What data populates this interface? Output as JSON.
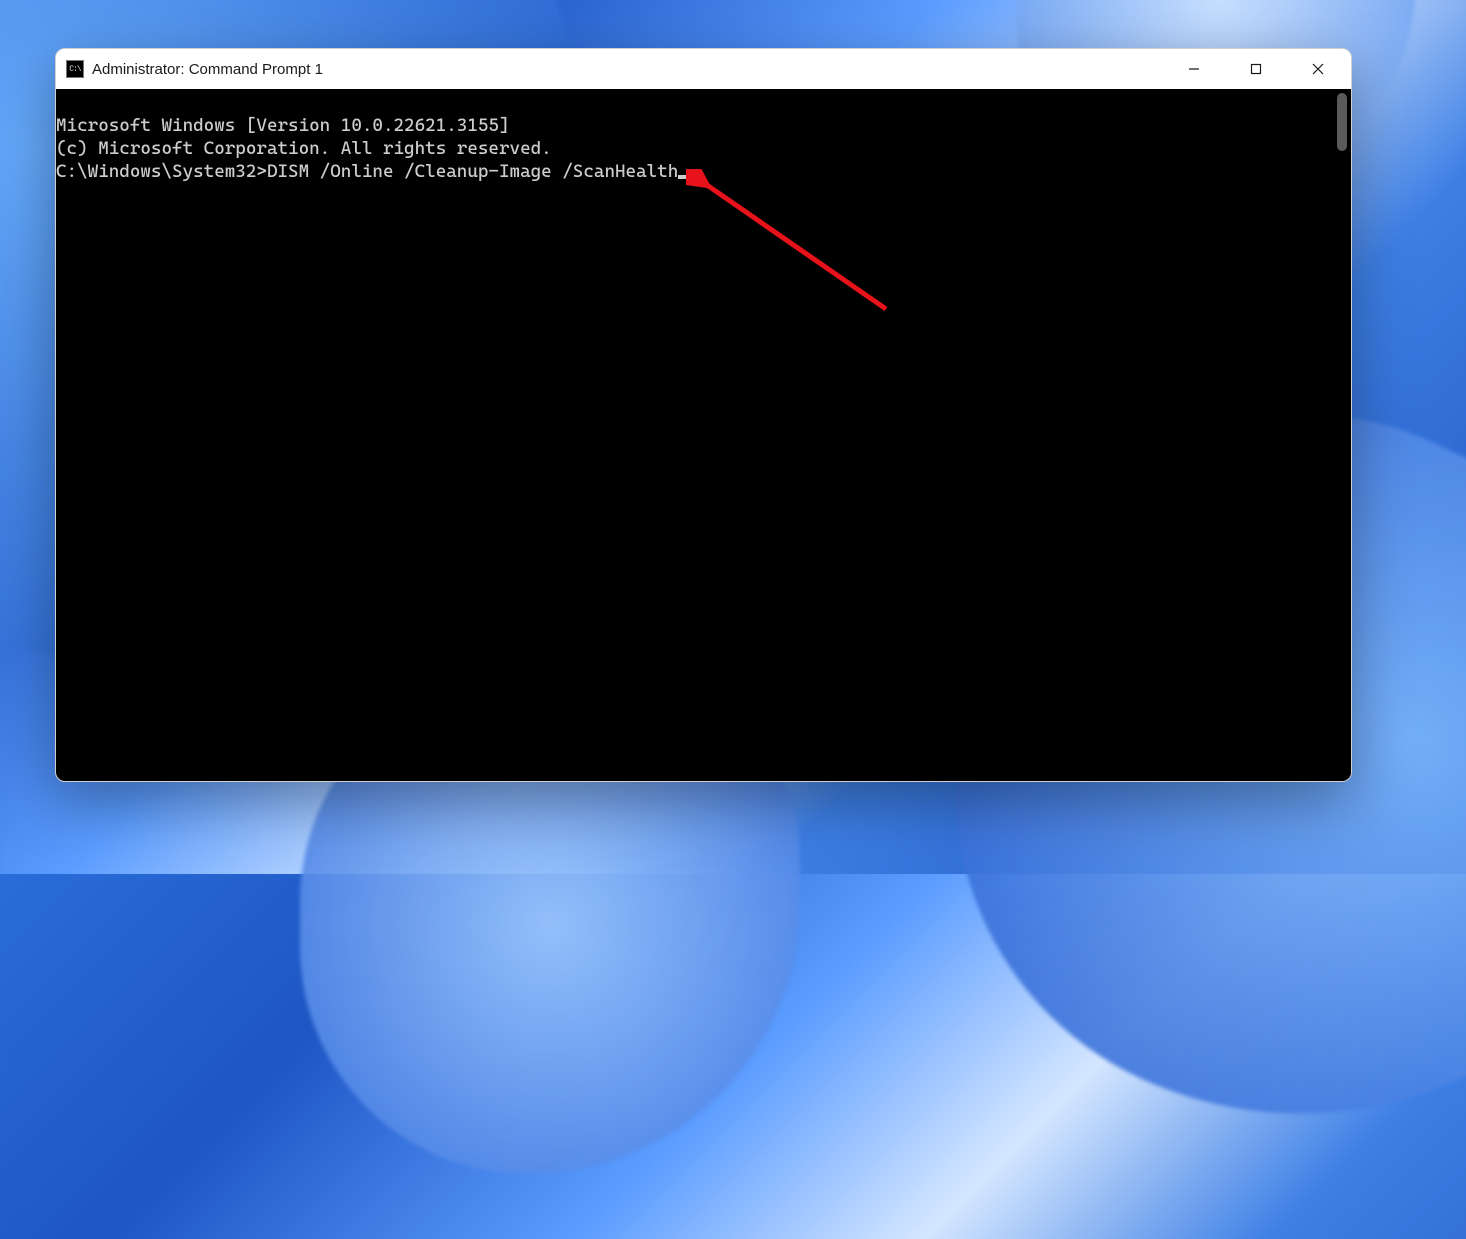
{
  "window": {
    "title": "Administrator: Command Prompt 1"
  },
  "terminal": {
    "line1": "Microsoft Windows [Version 10.0.22621.3155]",
    "line2": "(c) Microsoft Corporation. All rights reserved.",
    "blank": "",
    "prompt": "C:\\Windows\\System32>",
    "command": "DISM /Online /Cleanup-Image /ScanHealth"
  },
  "icons": {
    "app": "C:\\",
    "minimize": "minimize-icon",
    "maximize": "maximize-icon",
    "close": "close-icon"
  }
}
